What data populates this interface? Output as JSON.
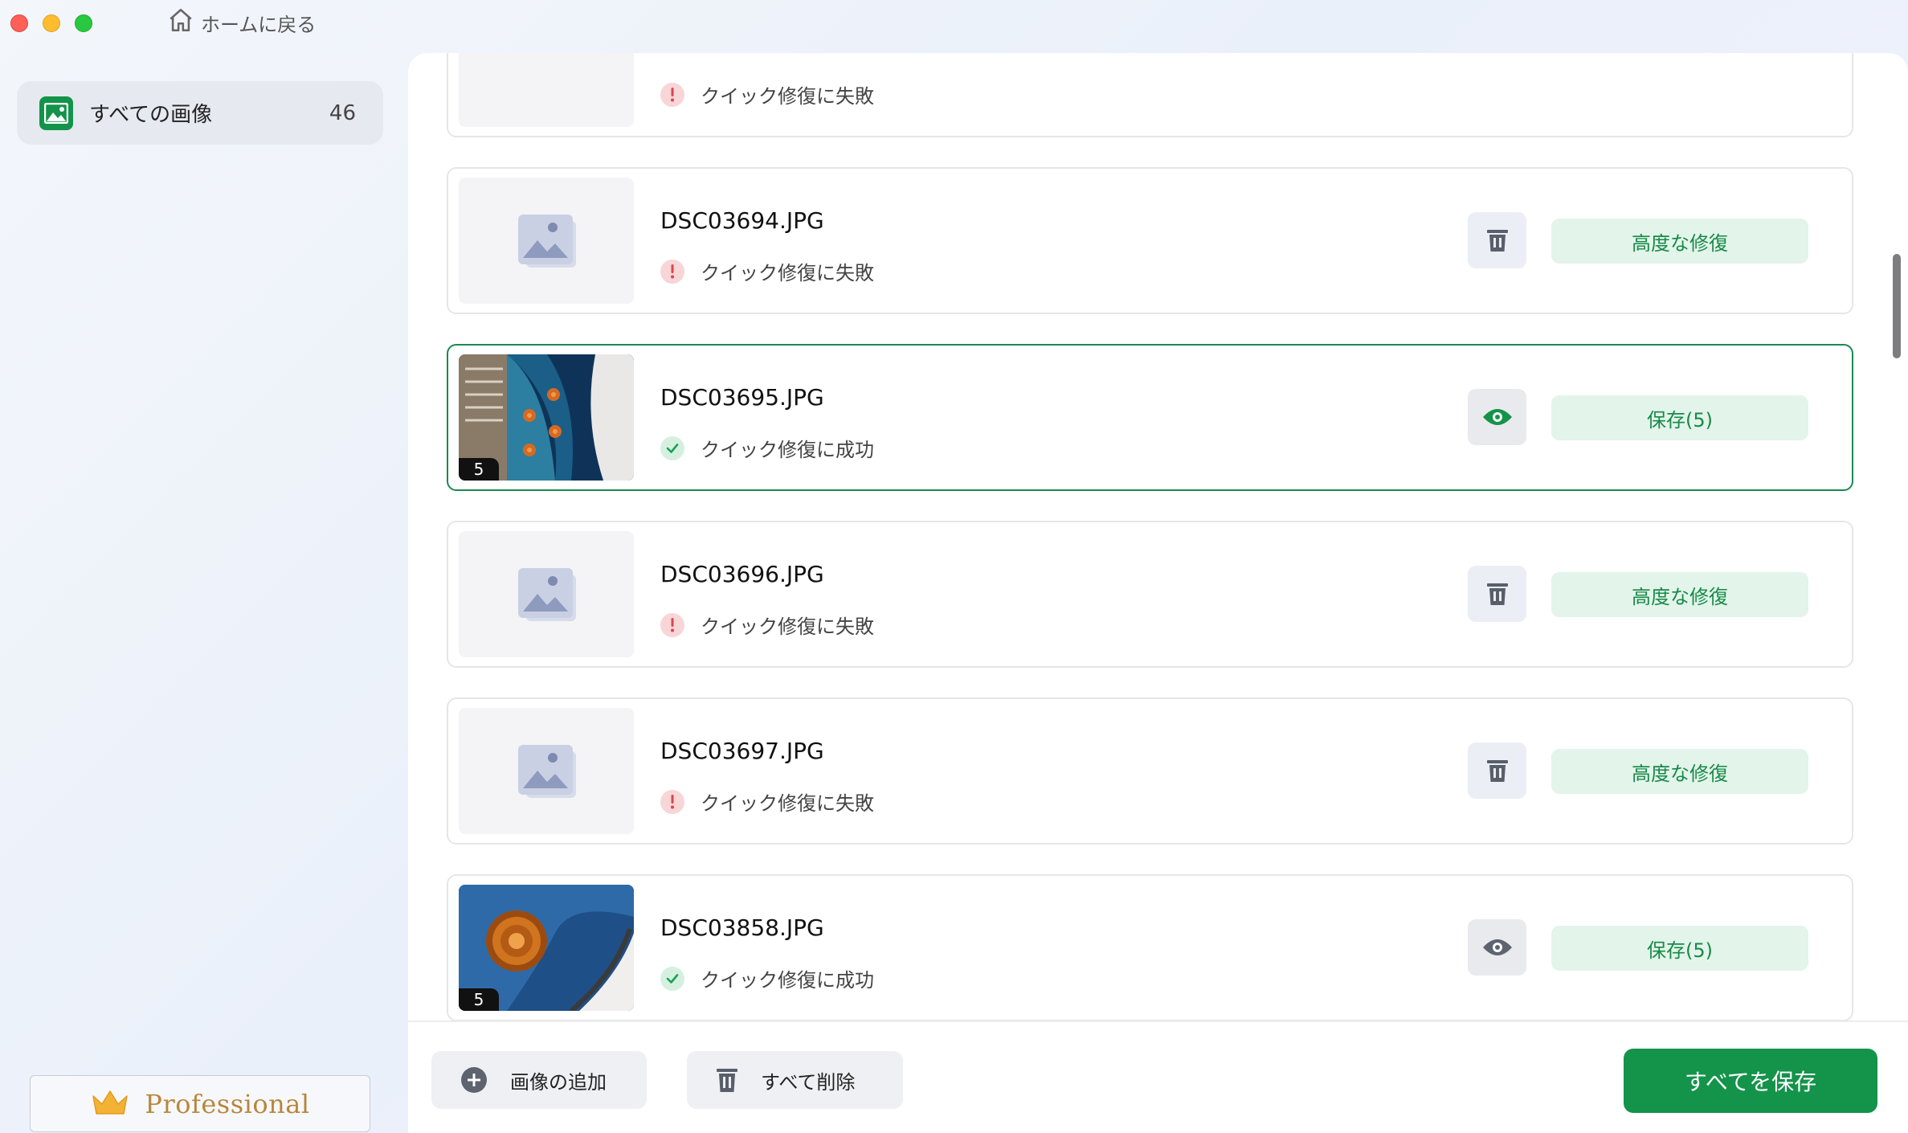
{
  "header": {
    "home_label": "ホームに戻る"
  },
  "sidebar": {
    "all_images_label": "すべての画像",
    "all_images_count": "46",
    "pro_label": "Professional"
  },
  "files": [
    {
      "name": "",
      "status": "クイック修復に失敗",
      "state": "fail",
      "action": ""
    },
    {
      "name": "DSC03694.JPG",
      "status": "クイック修復に失敗",
      "state": "fail",
      "action": "高度な修復"
    },
    {
      "name": "DSC03695.JPG",
      "status": "クイック修復に成功",
      "state": "ok",
      "action": "保存(5)",
      "badge": "5",
      "selected": true
    },
    {
      "name": "DSC03696.JPG",
      "status": "クイック修復に失敗",
      "state": "fail",
      "action": "高度な修復"
    },
    {
      "name": "DSC03697.JPG",
      "status": "クイック修復に失敗",
      "state": "fail",
      "action": "高度な修復"
    },
    {
      "name": "DSC03858.JPG",
      "status": "クイック修復に成功",
      "state": "ok",
      "action": "保存(5)",
      "badge": "5"
    }
  ],
  "footer": {
    "add_label": "画像の追加",
    "delete_all_label": "すべて削除",
    "save_all_label": "すべてを保存"
  },
  "colors": {
    "accent": "#14934a",
    "fail": "#d9464f",
    "success_bg": "#e3f4ea",
    "selected_border": "#1a8a4f"
  },
  "icons": {
    "home": "home-icon",
    "gallery": "image-icon",
    "crown": "crown-icon",
    "trash": "trash-icon",
    "eye": "eye-icon",
    "plus": "plus-circle-icon"
  }
}
